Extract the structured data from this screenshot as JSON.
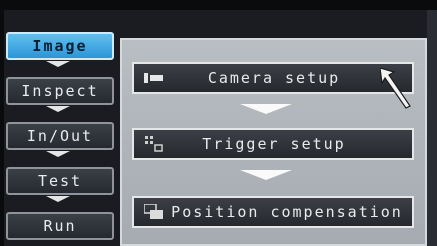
{
  "menu": {
    "items": [
      {
        "label": "Image",
        "active": true
      },
      {
        "label": "Inspect",
        "active": false
      },
      {
        "label": "In/Out",
        "active": false
      },
      {
        "label": "Test",
        "active": false
      },
      {
        "label": "Run",
        "active": false
      }
    ]
  },
  "panel": {
    "buttons": [
      {
        "label": "Camera setup",
        "icon": "camera-icon"
      },
      {
        "label": "Trigger setup",
        "icon": "trigger-icon"
      },
      {
        "label": "Position compensation",
        "icon": "position-icon"
      }
    ],
    "pointer_icon": "arrow-pointer-icon"
  },
  "colors": {
    "active_tab": "#3aa8e6",
    "panel_bg": "#b3b8bd",
    "button_bg": "#2e3238",
    "text": "#e9eaec"
  }
}
